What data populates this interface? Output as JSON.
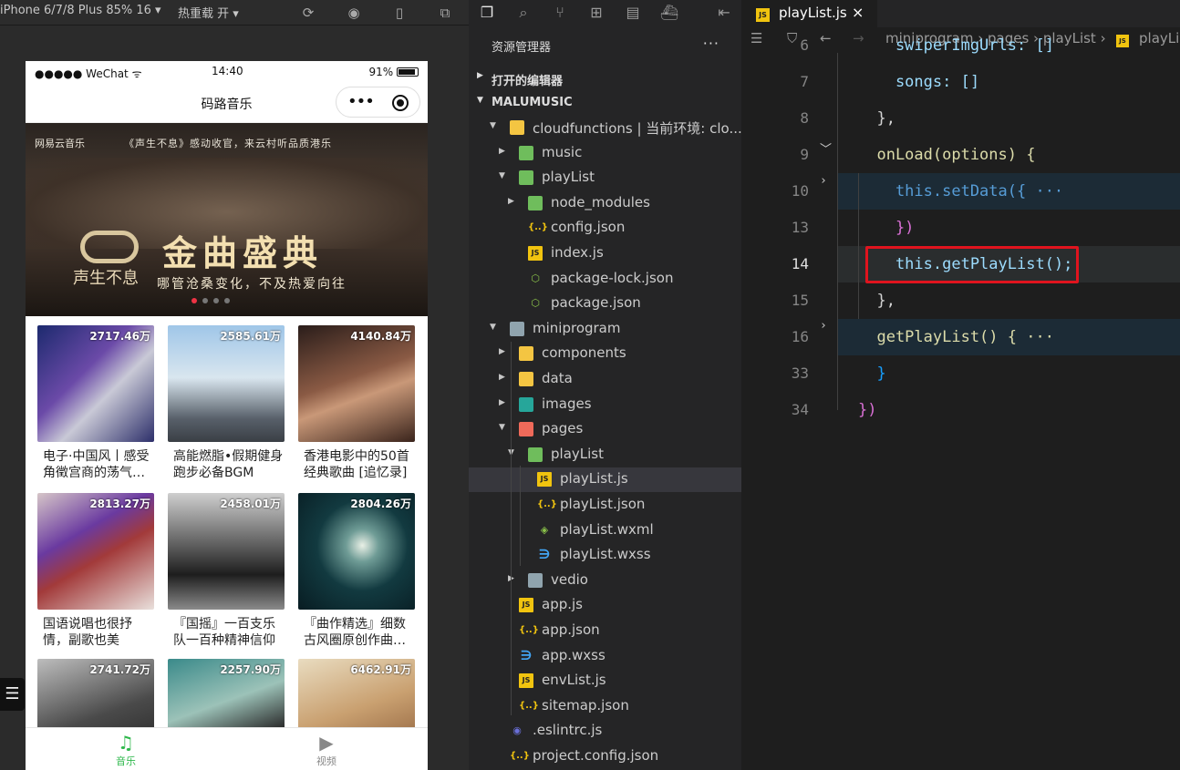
{
  "simulator": {
    "device_label": "iPhone 6/7/8 Plus 85% 16 ▾",
    "hot_reload_label": "热重载 开 ▾",
    "status": {
      "signal": "●●●●● WeChat",
      "time": "14:40",
      "battery": "91%"
    },
    "nav_title": "码路音乐",
    "banner": {
      "logo_text": "网易云音乐",
      "top_text": "《声生不息》感动收官，来云村听品质港乐",
      "big_text": "金曲盛典",
      "brand_text": "声生不息",
      "sub_text": "哪管沧桑变化，不及热爱向往"
    },
    "playlists": [
      {
        "count": "2717.46万",
        "name": "电子·中国风丨感受角徵宫商的荡气…"
      },
      {
        "count": "2585.61万",
        "name": "高能燃脂•假期健身跑步必备BGM"
      },
      {
        "count": "4140.84万",
        "name": "香港电影中的50首经典歌曲 [追忆录]"
      },
      {
        "count": "2813.27万",
        "name": "国语说唱也很抒情，副歌也美"
      },
      {
        "count": "2458.01万",
        "name": "『国摇』一百支乐队一百种精神信仰"
      },
      {
        "count": "2804.26万",
        "name": "『曲作精选』细数古风圈原创作曲…"
      },
      {
        "count": "2741.72万",
        "name": ""
      },
      {
        "count": "2257.90万",
        "name": ""
      },
      {
        "count": "6462.91万",
        "name": ""
      }
    ],
    "tabbar": {
      "music": "音乐",
      "video": "视频"
    }
  },
  "explorer": {
    "title": "资源管理器",
    "more": "···",
    "open_editors": "打开的编辑器",
    "project": "MALUMUSIC",
    "tree": [
      {
        "label": "cloudfunctions | 当前环境: clo...",
        "depth": 0,
        "type": "folder",
        "open": true
      },
      {
        "label": "music",
        "depth": 1,
        "type": "folder",
        "open": false
      },
      {
        "label": "playList",
        "depth": 1,
        "type": "folder",
        "open": true
      },
      {
        "label": "node_modules",
        "depth": 2,
        "type": "folder",
        "open": false
      },
      {
        "label": "config.json",
        "depth": 2,
        "type": "json"
      },
      {
        "label": "index.js",
        "depth": 2,
        "type": "js"
      },
      {
        "label": "package-lock.json",
        "depth": 2,
        "type": "node"
      },
      {
        "label": "package.json",
        "depth": 2,
        "type": "node"
      },
      {
        "label": "miniprogram",
        "depth": 0,
        "type": "folder",
        "open": true
      },
      {
        "label": "components",
        "depth": 1,
        "type": "folder",
        "open": false
      },
      {
        "label": "data",
        "depth": 1,
        "type": "folder",
        "open": false
      },
      {
        "label": "images",
        "depth": 1,
        "type": "folder",
        "open": false
      },
      {
        "label": "pages",
        "depth": 1,
        "type": "folder",
        "open": true
      },
      {
        "label": "playList",
        "depth": 2,
        "type": "folder",
        "open": true
      },
      {
        "label": "playList.js",
        "depth": 3,
        "type": "js",
        "selected": true
      },
      {
        "label": "playList.json",
        "depth": 3,
        "type": "json"
      },
      {
        "label": "playList.wxml",
        "depth": 3,
        "type": "wxml"
      },
      {
        "label": "playList.wxss",
        "depth": 3,
        "type": "css"
      },
      {
        "label": "vedio",
        "depth": 2,
        "type": "folder",
        "open": false
      },
      {
        "label": "app.js",
        "depth": 1,
        "type": "js"
      },
      {
        "label": "app.json",
        "depth": 1,
        "type": "json"
      },
      {
        "label": "app.wxss",
        "depth": 1,
        "type": "css"
      },
      {
        "label": "envList.js",
        "depth": 1,
        "type": "js"
      },
      {
        "label": "sitemap.json",
        "depth": 1,
        "type": "json"
      },
      {
        "label": ".eslintrc.js",
        "depth": 0,
        "type": "eslint"
      },
      {
        "label": "project.config.json",
        "depth": 0,
        "type": "json"
      }
    ]
  },
  "editor": {
    "tab_label": "playList.js",
    "tab_close": "×",
    "breadcrumb": "miniprogram › pages › playList ›",
    "breadcrumb_file": "playLis",
    "code": [
      {
        "ln": "6",
        "text": "    swiperImgUrls: []"
      },
      {
        "ln": "7",
        "text": "    songs: []"
      },
      {
        "ln": "8",
        "text": "  },"
      },
      {
        "ln": "9",
        "text": "  onLoad(options) {"
      },
      {
        "ln": "10",
        "text": "    this.setData({ ···"
      },
      {
        "ln": "13",
        "text": "    })"
      },
      {
        "ln": "14",
        "text": "    this.getPlayList();"
      },
      {
        "ln": "15",
        "text": "  },"
      },
      {
        "ln": "16",
        "text": "  getPlayList() { ···"
      },
      {
        "ln": "33",
        "text": "  }"
      },
      {
        "ln": "34",
        "text": "})"
      }
    ]
  }
}
